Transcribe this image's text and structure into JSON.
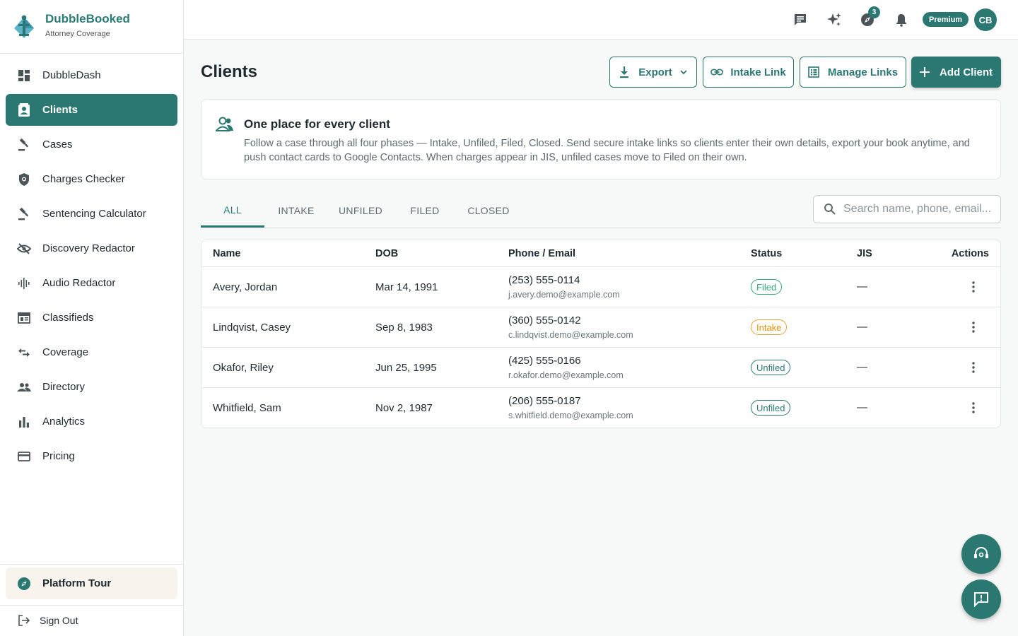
{
  "brand": {
    "name": "DubbleBooked",
    "subtitle": "Attorney Coverage"
  },
  "sidebar": {
    "items": [
      {
        "label": "DubbleDash",
        "icon": "dashboard-icon"
      },
      {
        "label": "Clients",
        "icon": "contact-card-icon",
        "active": true
      },
      {
        "label": "Cases",
        "icon": "gavel-icon"
      },
      {
        "label": "Charges Checker",
        "icon": "shield-search-icon"
      },
      {
        "label": "Sentencing Calculator",
        "icon": "gavel-icon"
      },
      {
        "label": "Discovery Redactor",
        "icon": "eye-off-icon"
      },
      {
        "label": "Audio Redactor",
        "icon": "waveform-icon"
      },
      {
        "label": "Classifieds",
        "icon": "newspaper-icon"
      },
      {
        "label": "Coverage",
        "icon": "swap-arrows-icon"
      },
      {
        "label": "Directory",
        "icon": "people-icon"
      },
      {
        "label": "Analytics",
        "icon": "bar-chart-icon"
      },
      {
        "label": "Pricing",
        "icon": "credit-card-icon"
      }
    ],
    "tour_label": "Platform Tour",
    "signout_label": "Sign Out"
  },
  "topbar": {
    "notification_count": "3",
    "plan_badge": "Premium",
    "avatar_initials": "CB"
  },
  "page": {
    "title": "Clients",
    "buttons": {
      "export": "Export",
      "intake_link": "Intake Link",
      "manage_links": "Manage Links",
      "add_client": "Add Client"
    }
  },
  "info": {
    "title": "One place for every client",
    "body": "Follow a case through all four phases — Intake, Unfiled, Filed, Closed. Send secure intake links so clients enter their own details, export your book anytime, and push contact cards to Google Contacts. When charges appear in JIS, unfiled cases move to Filed on their own."
  },
  "tabs": [
    "ALL",
    "INTAKE",
    "UNFILED",
    "FILED",
    "CLOSED"
  ],
  "active_tab": "ALL",
  "search": {
    "placeholder": "Search name, phone, email..."
  },
  "table": {
    "columns": [
      "Name",
      "DOB",
      "Phone / Email",
      "Status",
      "JIS",
      "Actions"
    ],
    "rows": [
      {
        "name": "Avery, Jordan",
        "dob": "Mar 14, 1991",
        "phone": "(253) 555-0114",
        "email": "j.avery.demo@example.com",
        "status": "Filed",
        "jis": "—"
      },
      {
        "name": "Lindqvist, Casey",
        "dob": "Sep 8, 1983",
        "phone": "(360) 555-0142",
        "email": "c.lindqvist.demo@example.com",
        "status": "Intake",
        "jis": "—"
      },
      {
        "name": "Okafor, Riley",
        "dob": "Jun 25, 1995",
        "phone": "(425) 555-0166",
        "email": "r.okafor.demo@example.com",
        "status": "Unfiled",
        "jis": "—"
      },
      {
        "name": "Whitfield, Sam",
        "dob": "Nov 2, 1987",
        "phone": "(206) 555-0187",
        "email": "s.whitfield.demo@example.com",
        "status": "Unfiled",
        "jis": "—"
      }
    ]
  },
  "colors": {
    "accent": "#2b7873",
    "filed": "#2fa877",
    "intake": "#e6940e"
  }
}
